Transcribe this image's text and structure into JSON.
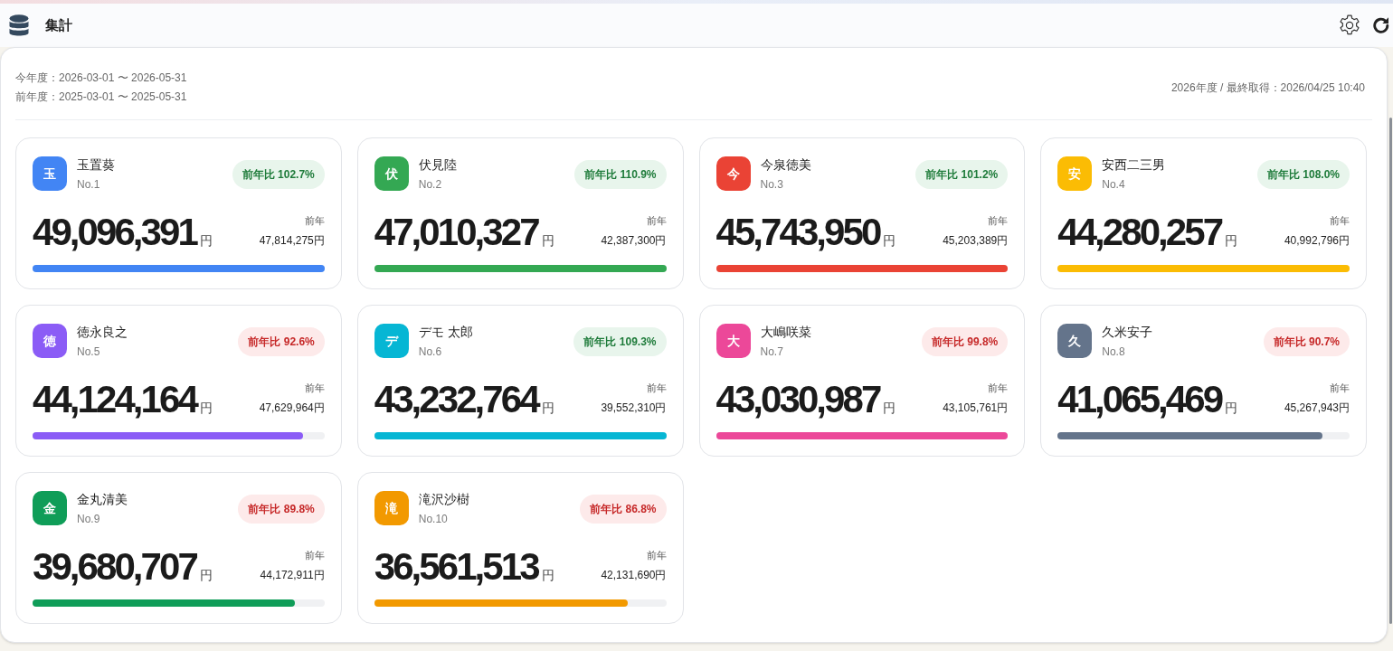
{
  "header": {
    "title": "集計"
  },
  "period": {
    "current": "今年度：2026-03-01 〜 2026-05-31",
    "previous": "前年度：2025-03-01 〜 2025-05-31",
    "status": "2026年度 / 最終取得：2026/04/25 10:40"
  },
  "members": [
    {
      "initial": "玉",
      "name": "玉置葵",
      "rank": "No.1",
      "ratio": "前年比 102.7%",
      "increase": true,
      "amount": "49,096,391",
      "unit": "円",
      "prev_label": "前年",
      "prev_amount": "47,814,275円",
      "level": 1,
      "color": "#4285f4"
    },
    {
      "initial": "伏",
      "name": "伏見陸",
      "rank": "No.2",
      "ratio": "前年比 110.9%",
      "increase": true,
      "amount": "47,010,327",
      "unit": "円",
      "prev_label": "前年",
      "prev_amount": "42,387,300円",
      "level": 1,
      "color": "#34a853"
    },
    {
      "initial": "今",
      "name": "今泉徳美",
      "rank": "No.3",
      "ratio": "前年比 101.2%",
      "increase": true,
      "amount": "45,743,950",
      "unit": "円",
      "prev_label": "前年",
      "prev_amount": "45,203,389円",
      "level": 1,
      "color": "#ea4335"
    },
    {
      "initial": "安",
      "name": "安西二三男",
      "rank": "No.4",
      "ratio": "前年比 108.0%",
      "increase": true,
      "amount": "44,280,257",
      "unit": "円",
      "prev_label": "前年",
      "prev_amount": "40,992,796円",
      "level": 1,
      "color": "#fbbc04"
    },
    {
      "initial": "徳",
      "name": "徳永良之",
      "rank": "No.5",
      "ratio": "前年比 92.6%",
      "increase": false,
      "amount": "44,124,164",
      "unit": "円",
      "prev_label": "前年",
      "prev_amount": "47,629,964円",
      "level": 0.926,
      "color": "#8b5cf6"
    },
    {
      "initial": "デ",
      "name": "デモ 太郎",
      "rank": "No.6",
      "ratio": "前年比 109.3%",
      "increase": true,
      "amount": "43,232,764",
      "unit": "円",
      "prev_label": "前年",
      "prev_amount": "39,552,310円",
      "level": 1,
      "color": "#06b6d4"
    },
    {
      "initial": "大",
      "name": "大嶋咲菜",
      "rank": "No.7",
      "ratio": "前年比 99.8%",
      "increase": false,
      "amount": "43,030,987",
      "unit": "円",
      "prev_label": "前年",
      "prev_amount": "43,105,761円",
      "level": 1,
      "color": "#ec4899"
    },
    {
      "initial": "久",
      "name": "久米安子",
      "rank": "No.8",
      "ratio": "前年比 90.7%",
      "increase": false,
      "amount": "41,065,469",
      "unit": "円",
      "prev_label": "前年",
      "prev_amount": "45,267,943円",
      "level": 0.907,
      "color": "#64748b"
    },
    {
      "initial": "金",
      "name": "金丸清美",
      "rank": "No.9",
      "ratio": "前年比 89.8%",
      "increase": false,
      "amount": "39,680,707",
      "unit": "円",
      "prev_label": "前年",
      "prev_amount": "44,172,911円",
      "level": 0.898,
      "color": "#0f9d58"
    },
    {
      "initial": "滝",
      "name": "滝沢沙樹",
      "rank": "No.10",
      "ratio": "前年比 86.8%",
      "increase": false,
      "amount": "36,561,513",
      "unit": "円",
      "prev_label": "前年",
      "prev_amount": "42,131,690円",
      "level": 0.868,
      "color": "#f29900"
    }
  ]
}
